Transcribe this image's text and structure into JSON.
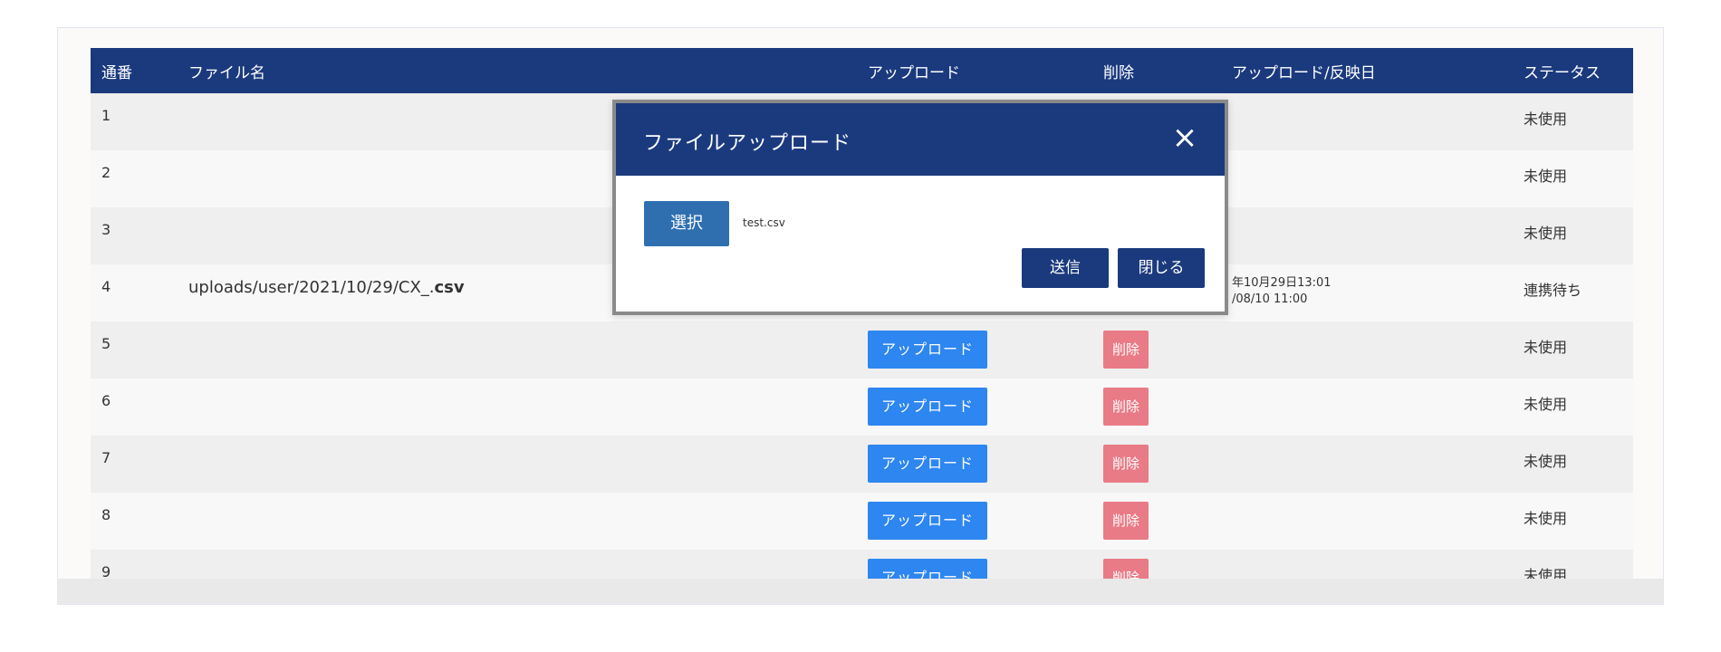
{
  "table": {
    "headers": {
      "number": "通番",
      "filename": "ファイル名",
      "upload": "アップロード",
      "delete": "削除",
      "date": "アップロード/反映日",
      "status": "ステータス"
    },
    "rows": [
      {
        "number": "1",
        "filename": "",
        "upload_label": "",
        "delete_label": "",
        "date1": "",
        "date2": "",
        "status": "未使用"
      },
      {
        "number": "2",
        "filename": "",
        "upload_label": "",
        "delete_label": "",
        "date1": "",
        "date2": "",
        "status": "未使用"
      },
      {
        "number": "3",
        "filename": "",
        "upload_label": "",
        "delete_label": "",
        "date1": "",
        "date2": "",
        "status": "未使用"
      },
      {
        "number": "4",
        "filename_prefix": "uploads/user/2021/10/29/CX_.",
        "filename_ext": "csv",
        "upload_label": "",
        "delete_label": "",
        "date1": "年10月29日13:01",
        "date2": "/08/10 11:00",
        "status": "連携待ち"
      },
      {
        "number": "5",
        "filename": "",
        "upload_label": "アップロード",
        "delete_label": "削除",
        "date1": "",
        "date2": "",
        "status": "未使用"
      },
      {
        "number": "6",
        "filename": "",
        "upload_label": "アップロード",
        "delete_label": "削除",
        "date1": "",
        "date2": "",
        "status": "未使用"
      },
      {
        "number": "7",
        "filename": "",
        "upload_label": "アップロード",
        "delete_label": "削除",
        "date1": "",
        "date2": "",
        "status": "未使用"
      },
      {
        "number": "8",
        "filename": "",
        "upload_label": "アップロード",
        "delete_label": "削除",
        "date1": "",
        "date2": "",
        "status": "未使用"
      },
      {
        "number": "9",
        "filename": "",
        "upload_label": "アップロード",
        "delete_label": "削除",
        "date1": "",
        "date2": "",
        "status": "未使用"
      }
    ]
  },
  "modal": {
    "title": "ファイルアップロード",
    "close_icon": "×",
    "select_label": "選択",
    "selected_file": "test.csv",
    "send_label": "送信",
    "close_label": "閉じる"
  },
  "colors": {
    "header_bg": "#1b3a7e",
    "upload_button": "#2e86f0",
    "delete_button": "#e97b86",
    "select_button": "#2f6fb0"
  }
}
